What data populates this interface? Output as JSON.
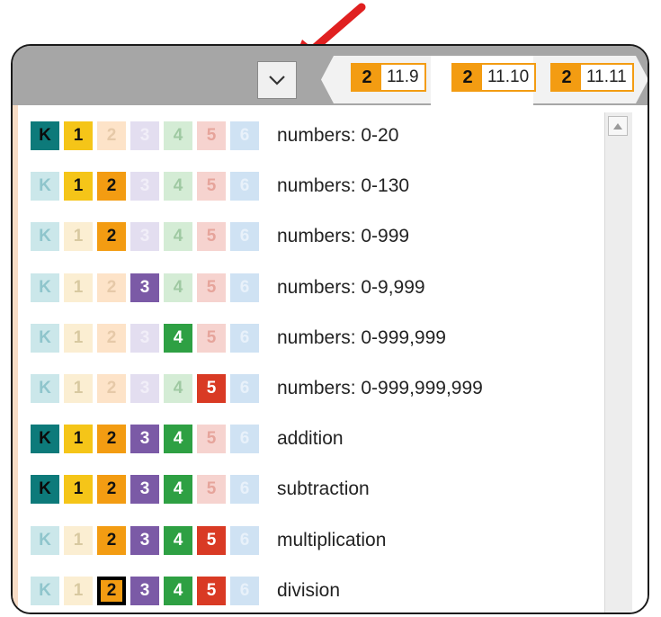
{
  "colors": {
    "K": "#0d7a7a",
    "1": "#f5c518",
    "2": "#f39c12",
    "3": "#7b5aa6",
    "4": "#2ea043",
    "5": "#d93a24",
    "6": "#3c8fd1",
    "K_faded": "#cbe7ea",
    "1_faded": "#fbeed2",
    "2_faded": "#fde3c8",
    "3_faded": "#e3def0",
    "4_faded": "#d4ecd5",
    "5_faded": "#f6d3cf",
    "6_faded": "#cfe2f3",
    "pointer_arrow": "#e02020"
  },
  "grade_labels": [
    "K",
    "1",
    "2",
    "3",
    "4",
    "5",
    "6"
  ],
  "toolbar": {
    "dropdown_icon": "chevron-down-icon",
    "chips": [
      {
        "grade": "2",
        "label": "11.9"
      },
      {
        "grade": "2",
        "label": "11.10"
      },
      {
        "grade": "2",
        "label": "11.11"
      }
    ],
    "active_chip": 1
  },
  "list": {
    "rows": [
      {
        "topic": "numbers: 0-20",
        "active": [
          "K",
          "1"
        ],
        "selected": null
      },
      {
        "topic": "numbers: 0-130",
        "active": [
          "1",
          "2"
        ],
        "selected": null
      },
      {
        "topic": "numbers: 0-999",
        "active": [
          "2"
        ],
        "selected": null
      },
      {
        "topic": "numbers: 0-9,999",
        "active": [
          "3"
        ],
        "selected": null
      },
      {
        "topic": "numbers: 0-999,999",
        "active": [
          "4"
        ],
        "selected": null
      },
      {
        "topic": "numbers: 0-999,999,999",
        "active": [
          "5"
        ],
        "selected": null
      },
      {
        "topic": "addition",
        "active": [
          "K",
          "1",
          "2",
          "3",
          "4"
        ],
        "selected": null
      },
      {
        "topic": "subtraction",
        "active": [
          "K",
          "1",
          "2",
          "3",
          "4"
        ],
        "selected": null
      },
      {
        "topic": "multiplication",
        "active": [
          "2",
          "3",
          "4",
          "5"
        ],
        "selected": null
      },
      {
        "topic": "division",
        "active": [
          "2",
          "3",
          "4",
          "5"
        ],
        "selected": "2"
      }
    ]
  },
  "scrollbar": {
    "up_icon": "scroll-up-arrow-icon"
  }
}
